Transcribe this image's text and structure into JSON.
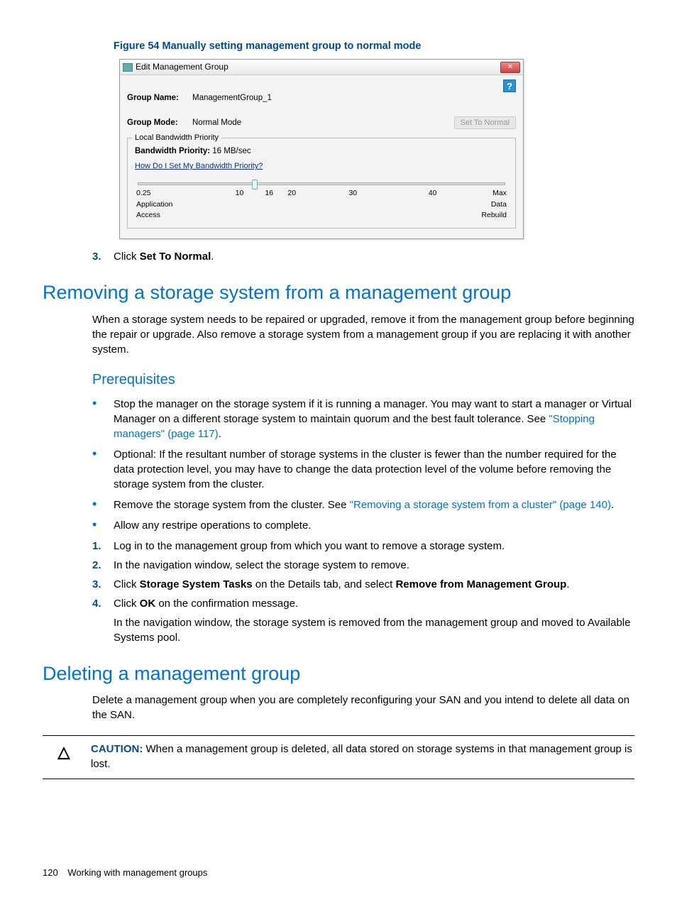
{
  "figure": {
    "caption": "Figure 54 Manually setting management group to normal mode"
  },
  "dialog": {
    "title": "Edit Management Group",
    "close_label": "✕",
    "help_label": "?",
    "field_group_name_label": "Group Name:",
    "field_group_name_value": "ManagementGroup_1",
    "field_group_mode_label": "Group Mode:",
    "field_group_mode_value": "Normal Mode",
    "set_normal_button": "Set To Normal",
    "bandwidth": {
      "legend": "Local Bandwidth Priority",
      "label": "Bandwidth Priority:",
      "value": "16 MB/sec",
      "help_link": "How Do I Set My Bandwidth Priority?",
      "ticks": {
        "t0": "0.25",
        "t1": "10",
        "t2": "16",
        "t3": "20",
        "t4": "30",
        "t5": "40",
        "tmax": "Max"
      },
      "left_label_1": "Application",
      "left_label_2": "Access",
      "right_label_1": "Data",
      "right_label_2": "Rebuild"
    }
  },
  "step3_prefix": "3.",
  "step3_text_a": "Click ",
  "step3_text_b": "Set To Normal",
  "step3_text_c": ".",
  "section_remove": {
    "heading": "Removing a storage system from a management group",
    "intro": "When a storage system needs to be repaired or upgraded, remove it from the management group before beginning the repair or upgrade. Also remove a storage system from a management group if you are replacing it with another system.",
    "prereq_heading": "Prerequisites",
    "bullets": {
      "b1a": "Stop the manager on the storage system if it is running a manager. You may want to start a manager or Virtual Manager on a different storage system to maintain quorum and the best fault tolerance. See ",
      "b1_link": "\"Stopping managers\" (page 117)",
      "b1c": ".",
      "b2": "Optional: If the resultant number of storage systems in the cluster is fewer than the number required for the data protection level, you may have to change the data protection level of the volume before removing the storage system from the cluster.",
      "b3a": "Remove the storage system from the cluster. See ",
      "b3_link": "\"Removing a storage system from a cluster\" (page 140)",
      "b3c": ".",
      "b4": "Allow any restripe operations to complete."
    },
    "steps": {
      "s1n": "1.",
      "s1": "Log in to the management group from which you want to remove a storage system.",
      "s2n": "2.",
      "s2": "In the navigation window, select the storage system to remove.",
      "s3n": "3.",
      "s3a": "Click ",
      "s3b": "Storage System Tasks",
      "s3c": " on the Details tab, and select ",
      "s3d": "Remove from Management Group",
      "s3e": ".",
      "s4n": "4.",
      "s4a": "Click ",
      "s4b": "OK",
      "s4c": " on the confirmation message."
    },
    "post": "In the navigation window, the storage system is removed from the management group and moved to Available Systems pool."
  },
  "section_delete": {
    "heading": "Deleting a management group",
    "intro": "Delete a management group when you are completely reconfiguring your SAN and you intend to delete all data on the SAN.",
    "caution_label": "CAUTION:",
    "caution_text": "   When a management group is deleted, all data stored on storage systems in that management group is lost."
  },
  "footer": {
    "page_number": "120",
    "chapter": "Working with management groups"
  }
}
